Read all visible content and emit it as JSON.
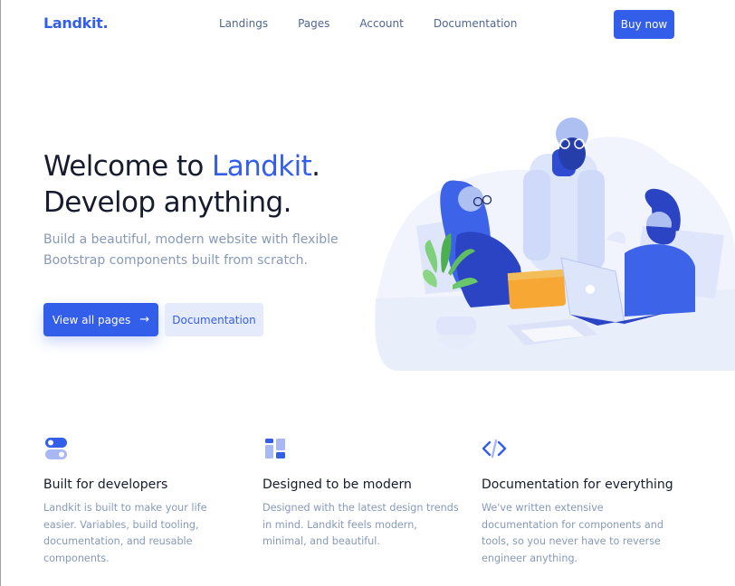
{
  "brand": {
    "name": "Landkit."
  },
  "nav": {
    "links": [
      "Landings",
      "Pages",
      "Account",
      "Documentation"
    ],
    "cta": "Buy now"
  },
  "hero": {
    "title_prefix": "Welcome to ",
    "title_accent": "Landkit",
    "title_suffix": ".",
    "title_line2": "Develop anything.",
    "subtitle": "Build a beautiful, modern website with flexible Bootstrap components built from scratch.",
    "primary_button": "View all pages",
    "secondary_button": "Documentation"
  },
  "features": [
    {
      "icon": "toggle-icon",
      "title": "Built for developers",
      "text": "Landkit is built to make your life easier. Variables, build tooling, documentation, and reusable components."
    },
    {
      "icon": "layout-icon",
      "title": "Designed to be modern",
      "text": "Designed with the latest design trends in mind. Landkit feels modern, minimal, and beautiful."
    },
    {
      "icon": "code-icon",
      "title": "Documentation for everything",
      "text": "We've written extensive documentation for components and tools, so you never have to reverse engineer anything."
    }
  ],
  "colors": {
    "primary": "#335eea",
    "primary_soft": "#e6ebfb",
    "heading": "#161c2d",
    "muted": "#869ab8",
    "nav": "#506690"
  }
}
